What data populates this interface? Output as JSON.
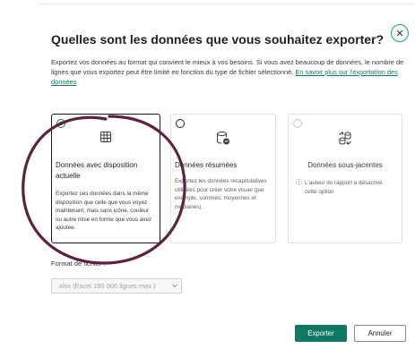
{
  "dialog": {
    "title": "Quelles sont les données que vous souhaitez exporter?",
    "close_icon": "close-icon",
    "description": "Exportez vos données au format qui convient le mieux à vos besoins. Si vous avez beaucoup de données, le nombre de lignes que vous exportez peut être limité en fonction du type de fichier sélectionné.",
    "learn_more_link": "En savoir plus sur l'exportation des données"
  },
  "options": [
    {
      "title": "Données avec disposition actuelle",
      "description": "Exportez ces données dans la même disposition que celle que vous voyez maintenant, mais sans icône, couleur ou autre mise en forme que vous avez ajoutée.",
      "icon": "table-grid-icon",
      "selected": true
    },
    {
      "title": "Données résumées",
      "description": "Exportez les données récapitulatives utilisées pour créer votre visuel (par exemple, sommes, moyennes et médianes).",
      "icon": "database-summary-icon",
      "selected": false
    },
    {
      "title": "Données sous-jacentes",
      "disabled_note": "L'auteur du rapport a désactivé cette option",
      "icon": "data-transfer-icon",
      "info_icon": "info-icon",
      "selected": false,
      "disabled": true
    }
  ],
  "file_format": {
    "label": "Format de fichier :",
    "value": ".xlsx (Excel 150 000 lignes max.)"
  },
  "buttons": {
    "export": "Exporter",
    "cancel": "Annuler"
  },
  "colors": {
    "accent": "#117865",
    "annotation": "#5b2340"
  }
}
